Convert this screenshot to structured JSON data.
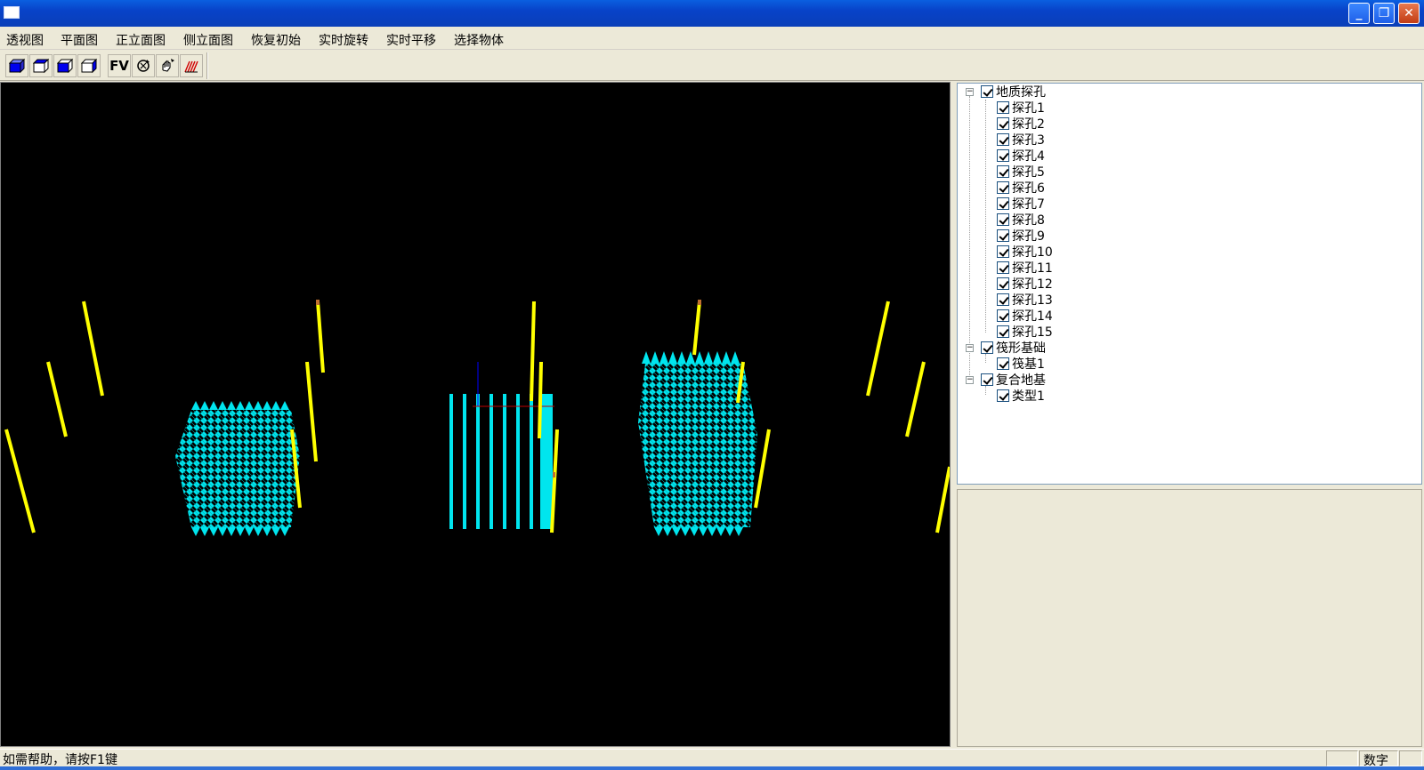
{
  "window": {
    "title": ""
  },
  "menu": [
    "透视图",
    "平面图",
    "正立面图",
    "侧立面图",
    "恢复初始",
    "实时旋转",
    "实时平移",
    "选择物体"
  ],
  "toolbar": {
    "tools": [
      {
        "name": "perspective-view-cube-icon"
      },
      {
        "name": "top-view-cube-icon"
      },
      {
        "name": "front-view-cube-icon"
      },
      {
        "name": "side-view-cube-icon"
      },
      {
        "name": "fv-button",
        "label": "FV"
      },
      {
        "name": "rotate-icon"
      },
      {
        "name": "pan-hand-icon"
      },
      {
        "name": "select-object-icon"
      }
    ]
  },
  "colors": {
    "boreholes": "#ffff00",
    "foundation": "#00e5ee",
    "viewport_bg": "#000000"
  },
  "tree": {
    "groups": [
      {
        "label": "地质探孔",
        "checked": true,
        "children": [
          "探孔1",
          "探孔2",
          "探孔3",
          "探孔4",
          "探孔5",
          "探孔6",
          "探孔7",
          "探孔8",
          "探孔9",
          "探孔10",
          "探孔11",
          "探孔12",
          "探孔13",
          "探孔14",
          "探孔15"
        ]
      },
      {
        "label": "筏形基础",
        "checked": true,
        "children": [
          "筏基1"
        ]
      },
      {
        "label": "复合地基",
        "checked": true,
        "children": [
          "类型1"
        ]
      }
    ]
  },
  "status": {
    "help_text": "如需帮助，请按F1键",
    "num_indicator": "数字"
  }
}
